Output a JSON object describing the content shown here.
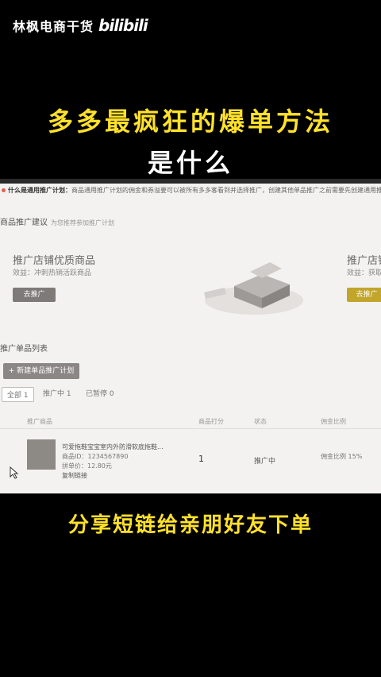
{
  "watermark": {
    "text": "林枫电商干货",
    "logo": "bilibili"
  },
  "headline": {
    "line1": "多多最疯狂的爆单方法",
    "line2": "是什么"
  },
  "subtitle": "分享短链给亲朋好友下单",
  "screen": {
    "info_label": "什么是通用推广计划：",
    "info_text": "商品通用推广计划的佣金和券溢要可以被所有多多客看到并选择推广，创建其他单品推广之前需要先创建通用推",
    "section_title": "商品推广建议",
    "section_hint": "为您推荐参加推广计划",
    "card_left": {
      "title": "推广店铺优质商品",
      "subtitle": "效益：冲刺热销活跃商品",
      "button": "去推广"
    },
    "card_right": {
      "title": "推广店铺",
      "subtitle": "效益：获取",
      "button": "去推广"
    },
    "list_title": "推广单品列表",
    "new_button": "+ 新建单品推广计划",
    "tabs": [
      "全部 1",
      "推广中 1",
      "已暂停 0"
    ],
    "columns": [
      "推广商品",
      "商品打分",
      "状态",
      "佣金比例"
    ],
    "row": {
      "title": "可爱拖鞋宝宝室内外防滑软底拖鞋...",
      "id": "商品ID：1234567890",
      "price": "拼单价：12.80元",
      "link": "复制链接",
      "rank": "1",
      "status": "推广中",
      "commission": "佣金比例 15%"
    }
  }
}
